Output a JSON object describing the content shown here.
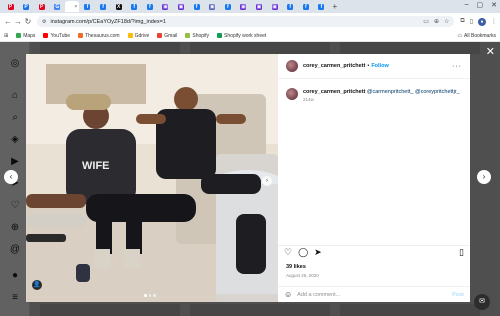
{
  "browser": {
    "tabs": [
      {
        "icon": "P",
        "color": "#e60023"
      },
      {
        "icon": "P",
        "color": "#1a73e8"
      },
      {
        "icon": "P",
        "color": "#e60023"
      },
      {
        "icon": "G",
        "color": "#4285f4"
      },
      {
        "icon": "",
        "color": "#ffffff",
        "active": true
      },
      {
        "icon": "f",
        "color": "#1877f2"
      },
      {
        "icon": "f",
        "color": "#1877f2"
      },
      {
        "icon": "X",
        "color": "#111111"
      },
      {
        "icon": "f",
        "color": "#1877f2"
      },
      {
        "icon": "f",
        "color": "#1877f2"
      },
      {
        "icon": "▣",
        "color": "#6b2fd6"
      },
      {
        "icon": "▣",
        "color": "#6b2fd6"
      },
      {
        "icon": "f",
        "color": "#1877f2"
      },
      {
        "icon": "▣",
        "color": "#555fba"
      },
      {
        "icon": "f",
        "color": "#1877f2"
      },
      {
        "icon": "▣",
        "color": "#6b2fd6"
      },
      {
        "icon": "▣",
        "color": "#6b2fd6"
      },
      {
        "icon": "▣",
        "color": "#6b2fd6"
      },
      {
        "icon": "f",
        "color": "#1877f2"
      },
      {
        "icon": "f",
        "color": "#1877f2"
      },
      {
        "icon": "f",
        "color": "#1877f2"
      }
    ],
    "url": "instagram.com/p/CEaYOyZF18d/?img_index=1",
    "bookmarks": [
      {
        "label": "Maps",
        "color": "#34a853"
      },
      {
        "label": "YouTube",
        "color": "#ff0000"
      },
      {
        "label": "Thesaurus.com",
        "color": "#f56b2a"
      },
      {
        "label": "Gdrive",
        "color": "#fbbc04"
      },
      {
        "label": "Gmail",
        "color": "#ea4335"
      },
      {
        "label": "Shopify",
        "color": "#95bf47"
      },
      {
        "label": "Shopify work sheet",
        "color": "#0f9d58"
      }
    ],
    "all_bookmarks": "All Bookmarks"
  },
  "post": {
    "username": "corey_carmen_pritchett",
    "follow_label": "Follow",
    "caption_user": "corey_carmen_pritchett",
    "caption_mentions": "@carmenpritchett_ @coreypritchettjr_",
    "caption_time": "214w",
    "likes": "39 likes",
    "date": "August 26, 2020",
    "comment_placeholder": "Add a comment...",
    "post_label": "Post"
  }
}
